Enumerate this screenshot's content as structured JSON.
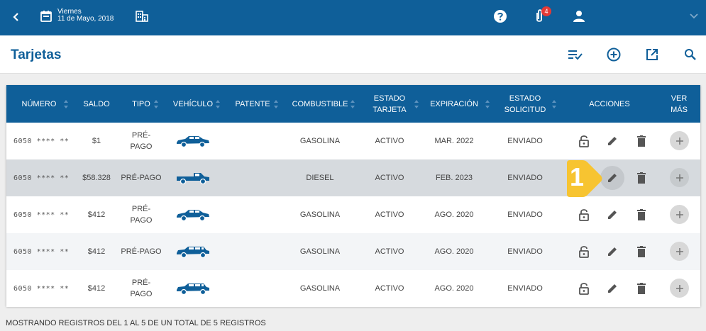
{
  "header": {
    "day": "Viernes",
    "date": "11 de Mayo, 2018",
    "notification_count": "4"
  },
  "page": {
    "title": "Tarjetas"
  },
  "table": {
    "columns": [
      "NÚMERO",
      "SALDO",
      "TIPO",
      "VEHÍCULO",
      "PATENTE",
      "COMBUSTIBLE",
      "ESTADO TARJETA",
      "EXPIRACIÓN",
      "ESTADO SOLICITUD",
      "ACCIONES",
      "VER MÁS"
    ],
    "rows": [
      {
        "numero": "6050 **** **",
        "saldo": "$1",
        "tipo": "PRÉ-PAGO",
        "vehiculo": "sedan-icon",
        "patente": "",
        "combustible": "GASOLINA",
        "estado_tarjeta": "ACTIVO",
        "expiracion": "MAR. 2022",
        "estado_solicitud": "ENVIADO"
      },
      {
        "numero": "6050 **** **",
        "saldo": "$58.328",
        "tipo": "PRÉ-PAGO",
        "vehiculo": "pickup-icon",
        "patente": "",
        "combustible": "DIESEL",
        "estado_tarjeta": "ACTIVO",
        "expiracion": "FEB. 2023",
        "estado_solicitud": "ENVIADO"
      },
      {
        "numero": "6050 **** **",
        "saldo": "$412",
        "tipo": "PRÉ-PAGO",
        "vehiculo": "sedan-icon",
        "patente": "",
        "combustible": "GASOLINA",
        "estado_tarjeta": "ACTIVO",
        "expiracion": "AGO. 2020",
        "estado_solicitud": "ENVIADO"
      },
      {
        "numero": "6050 **** **",
        "saldo": "$412",
        "tipo": "PRÉ-PAGO",
        "vehiculo": "wagon-icon",
        "patente": "",
        "combustible": "GASOLINA",
        "estado_tarjeta": "ACTIVO",
        "expiracion": "AGO. 2020",
        "estado_solicitud": "ENVIADO"
      },
      {
        "numero": "6050 **** **",
        "saldo": "$412",
        "tipo": "PRÉ-PAGO",
        "vehiculo": "wagon-icon",
        "patente": "",
        "combustible": "GASOLINA",
        "estado_tarjeta": "ACTIVO",
        "expiracion": "AGO. 2020",
        "estado_solicitud": "ENVIADO"
      }
    ]
  },
  "callout": {
    "step": "1"
  },
  "footer": {
    "text": "MOSTRANDO REGISTROS DEL 1 AL 5 DE UN TOTAL DE 5 REGISTROS"
  },
  "colors": {
    "primary": "#0f5f99",
    "callout": "#f7c431",
    "badge": "#e53935"
  }
}
